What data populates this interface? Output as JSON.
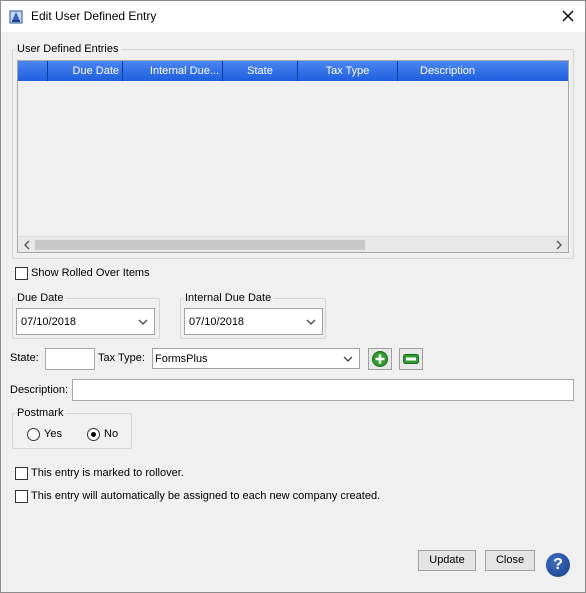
{
  "window": {
    "title": "Edit User Defined Entry"
  },
  "entries": {
    "legend": "User Defined Entries",
    "columns": [
      "",
      "Due Date",
      "Internal Due...",
      "State",
      "Tax Type",
      "Description"
    ]
  },
  "show_rolled_over": {
    "label": "Show Rolled Over Items",
    "checked": false
  },
  "due_date": {
    "legend": "Due Date",
    "value": "07/10/2018"
  },
  "internal_due_date": {
    "legend": "Internal Due Date",
    "value": "07/10/2018"
  },
  "state": {
    "label": "State:",
    "value": ""
  },
  "tax_type": {
    "label": "Tax Type:",
    "value": "FormsPlus"
  },
  "description": {
    "label": "Description:",
    "value": ""
  },
  "postmark": {
    "legend": "Postmark",
    "yes_label": "Yes",
    "no_label": "No",
    "selected": "No"
  },
  "rollover": {
    "label": "This entry is marked to rollover.",
    "checked": false
  },
  "auto_assign": {
    "label": "This entry will automatically be assigned to each new company created.",
    "checked": false
  },
  "buttons": {
    "update": "Update",
    "close": "Close",
    "help": "?"
  },
  "colors": {
    "header_blue": "#2f6fe8",
    "add_green": "#2f9a2f"
  }
}
